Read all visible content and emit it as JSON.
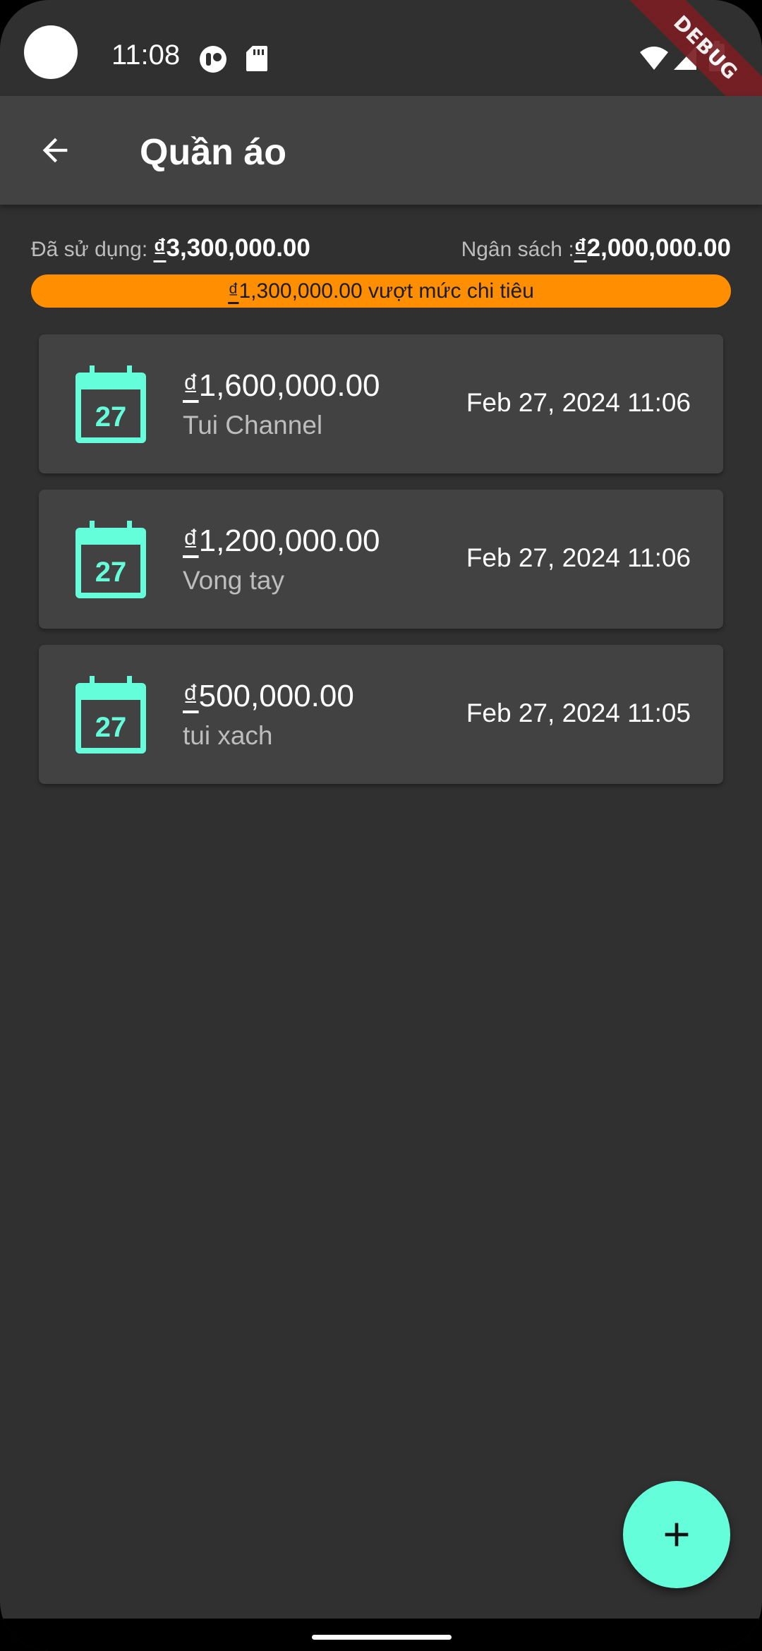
{
  "status_bar": {
    "time": "11:08",
    "icons": [
      "circle-app-icon",
      "sd-card-icon",
      "wifi-icon",
      "signal-icon",
      "battery-icon"
    ]
  },
  "debug_banner": "DEBUG",
  "app_bar": {
    "title": "Quần áo",
    "back_icon": "arrow-back-icon"
  },
  "summary": {
    "spent_label": "Đã sử dụng: ",
    "spent_currency": "₫",
    "spent_value": "3,300,000.00",
    "budget_label": "Ngân sách :",
    "budget_currency": "₫",
    "budget_value": "2,000,000.00",
    "over_currency": "₫",
    "over_amount": "1,300,000.00",
    "over_text": " vượt mức chi tiêu"
  },
  "transactions": [
    {
      "currency": "₫",
      "amount": "1,600,000.00",
      "note": "Tui Channel",
      "date": "Feb 27, 2024 11:06",
      "day": "27"
    },
    {
      "currency": "₫",
      "amount": "1,200,000.00",
      "note": "Vong tay",
      "date": "Feb 27, 2024 11:06",
      "day": "27"
    },
    {
      "currency": "₫",
      "amount": "500,000.00",
      "note": "tui xach",
      "date": "Feb 27, 2024 11:05",
      "day": "27"
    }
  ],
  "fab": {
    "icon": "add-icon"
  },
  "colors": {
    "background": "#303030",
    "surface": "#424242",
    "accent": "#64ffda",
    "warning": "#ff8f00"
  }
}
